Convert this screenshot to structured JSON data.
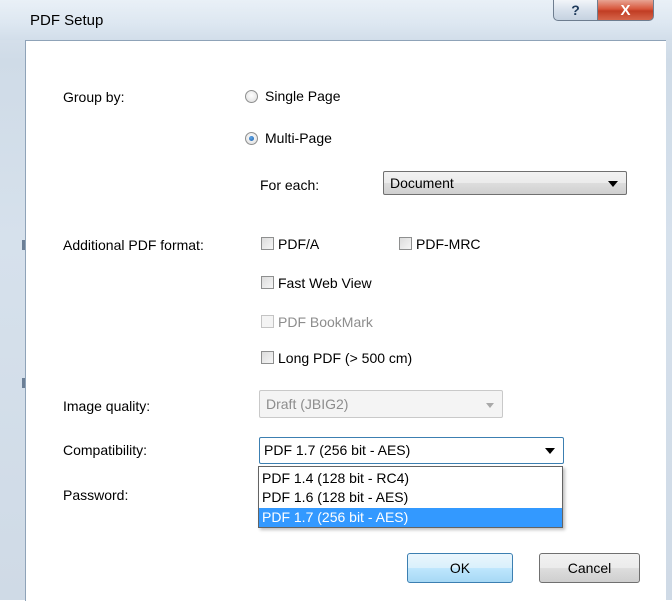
{
  "window": {
    "title": "PDF Setup",
    "help_glyph": "?",
    "close_glyph": "X"
  },
  "group_by": {
    "label": "Group by:",
    "options": [
      {
        "label": "Single Page",
        "selected": false
      },
      {
        "label": "Multi-Page",
        "selected": true
      }
    ],
    "for_each_label": "For each:",
    "for_each_value": "Document"
  },
  "additional_format": {
    "label": "Additional PDF format:",
    "options": [
      {
        "label": "PDF/A",
        "checked": false,
        "enabled": true
      },
      {
        "label": "PDF-MRC",
        "checked": false,
        "enabled": true
      },
      {
        "label": "Fast Web View",
        "checked": false,
        "enabled": true
      },
      {
        "label": "PDF BookMark",
        "checked": false,
        "enabled": false
      },
      {
        "label": "Long PDF (> 500 cm)",
        "checked": false,
        "enabled": true
      }
    ]
  },
  "image_quality": {
    "label": "Image quality:",
    "value": "Draft (JBIG2)",
    "enabled": false
  },
  "compatibility": {
    "label": "Compatibility:",
    "value": "PDF 1.7 (256 bit - AES)",
    "options": [
      "PDF 1.4 (128 bit - RC4)",
      "PDF 1.6 (128 bit - AES)",
      "PDF 1.7 (256 bit - AES)"
    ],
    "selected_option": "PDF 1.7 (256 bit - AES)"
  },
  "password": {
    "label": "Password:"
  },
  "buttons": {
    "ok": "OK",
    "cancel": "Cancel"
  },
  "colors": {
    "selection": "#3399ff",
    "close_button": "#c13d24",
    "default_button_border": "#3c7fb1"
  }
}
